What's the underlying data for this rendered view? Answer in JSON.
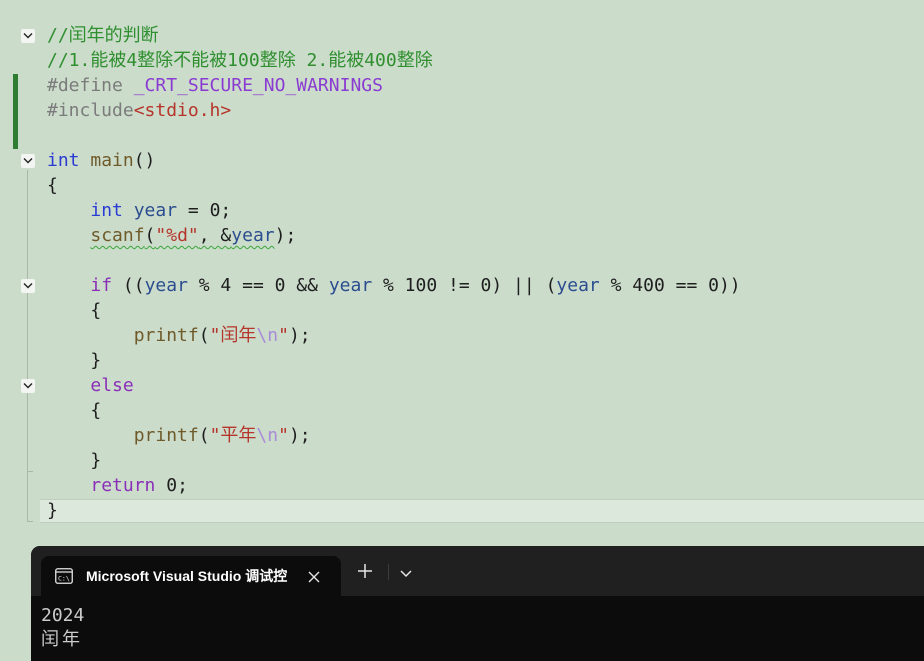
{
  "editor": {
    "lines": {
      "l1_comment": "//闰年的判断",
      "l2_comment": "//1.能被4整除不能被100整除 2.能被400整除",
      "l3_directive": "#define",
      "l3_macro": "_CRT_SECURE_NO_WARNINGS",
      "l4_directive": "#include",
      "l4_header": "<stdio.h>",
      "l6_type": "int",
      "l6_name": "main",
      "l6_paren": "()",
      "l7_brace": "{",
      "l8_type": "int",
      "l8_var": "year",
      "l8_rest": " = 0;",
      "l9_fn": "scanf",
      "l9_open": "(",
      "l9_str": "\"%d\"",
      "l9_mid": ", &",
      "l9_var": "year",
      "l9_close": ");",
      "l11_kw": "if",
      "l11_a": " ((",
      "l11_v1": "year",
      "l11_b": " % 4 == 0 && ",
      "l11_v2": "year",
      "l11_c": " % 100 != 0) || (",
      "l11_v3": "year",
      "l11_d": " % 400 == 0))",
      "l12_brace": "{",
      "l13_fn": "printf",
      "l13_open": "(",
      "l13_str": "\"闰年",
      "l13_esc": "\\n",
      "l13_end": "\"",
      "l13_close": ");",
      "l14_brace": "}",
      "l15_kw": "else",
      "l16_brace": "{",
      "l17_fn": "printf",
      "l17_open": "(",
      "l17_str": "\"平年",
      "l17_esc": "\\n",
      "l17_end": "\"",
      "l17_close": ");",
      "l18_brace": "}",
      "l19_kw": "return",
      "l19_rest": " 0;",
      "l20_brace": "}"
    }
  },
  "console": {
    "tab_title": "Microsoft Visual Studio 调试控",
    "output": [
      "2024",
      "闰年"
    ]
  },
  "theme": {
    "editor_bg": "#cbdccb",
    "console_bg": "#0c0c0c",
    "change_bar": "#2e7d32"
  },
  "icons": [
    "fold-collapse-icon",
    "console-app-icon",
    "close-icon",
    "plus-icon",
    "chevron-down-icon"
  ]
}
